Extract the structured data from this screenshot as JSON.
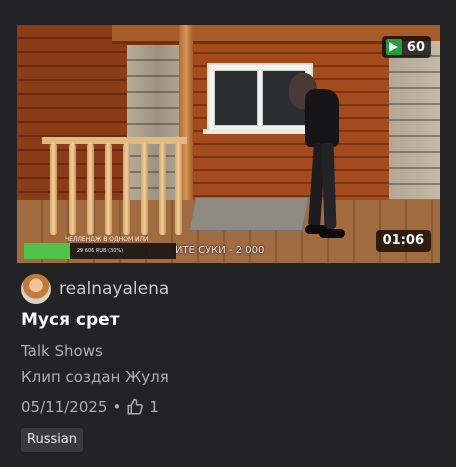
{
  "thumbnail": {
    "view_count": "60",
    "duration": "01:06",
    "overlay": {
      "caption": "ЧЕЛЛЕНДЖ В ОДНОМ ИЛИ",
      "goal_amount": "29 606 RUB (30%)",
      "goal_progress": 0.3,
      "ticker": "ИТЕ СУКИ - 2 000"
    },
    "colors": {
      "views_icon": "#1f9e3a",
      "goal_fill": "#4ec24a"
    }
  },
  "channel": {
    "name": "realnayalena",
    "avatar_icon": "avatar"
  },
  "clip": {
    "title": "Муся срет",
    "category": "Talk Shows",
    "created_by": "Клип создан Жуля",
    "date": "05/11/2025",
    "separator": "•",
    "likes": "1",
    "like_icon": "thumbs-up-icon"
  },
  "tags": [
    {
      "label": "Russian"
    }
  ]
}
